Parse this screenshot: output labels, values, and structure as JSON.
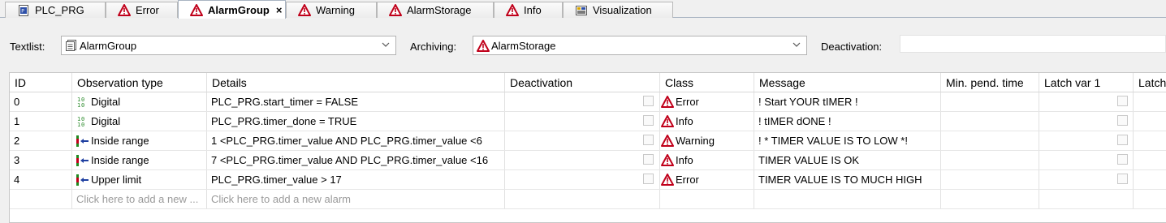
{
  "tabs": [
    {
      "label": "PLC_PRG",
      "icon": "program-icon",
      "active": false
    },
    {
      "label": "Error",
      "icon": "alarm-class-icon",
      "active": false
    },
    {
      "label": "AlarmGroup",
      "icon": "alarm-class-icon",
      "active": true,
      "close": "×"
    },
    {
      "label": "Warning",
      "icon": "alarm-class-icon",
      "active": false
    },
    {
      "label": "AlarmStorage",
      "icon": "alarm-storage-icon",
      "active": false
    },
    {
      "label": "Info",
      "icon": "alarm-class-icon",
      "active": false
    },
    {
      "label": "Visualization",
      "icon": "visualization-icon",
      "active": false
    }
  ],
  "form": {
    "textlist_label": "Textlist:",
    "textlist_value": "AlarmGroup",
    "archiving_label": "Archiving:",
    "archiving_value": "AlarmStorage",
    "deactivation_label": "Deactivation:",
    "deactivation_value": ""
  },
  "table": {
    "columns": [
      "ID",
      "Observation type",
      "Details",
      "Deactivation",
      "Class",
      "Message",
      "Min. pend. time",
      "Latch var 1",
      "Latch"
    ],
    "rows": [
      {
        "id": "0",
        "type": "Digital",
        "type_icon": "digital-icon",
        "details": "PLC_PRG.start_timer = FALSE",
        "class": "Error",
        "message": "! Start YOUR tIMER !"
      },
      {
        "id": "1",
        "type": "Digital",
        "type_icon": "digital-icon",
        "details": "PLC_PRG.timer_done = TRUE",
        "class": "Info",
        "message": "! tIMER dONE !"
      },
      {
        "id": "2",
        "type": "Inside range",
        "type_icon": "range-icon",
        "details": "1 <PLC_PRG.timer_value AND PLC_PRG.timer_value <6",
        "class": "Warning",
        "message": "! * TIMER VALUE IS TO LOW *!"
      },
      {
        "id": "3",
        "type": "Inside range",
        "type_icon": "range-icon",
        "details": "7 <PLC_PRG.timer_value AND PLC_PRG.timer_value <16",
        "class": "Info",
        "message": "TIMER VALUE IS OK"
      },
      {
        "id": "4",
        "type": "Upper limit",
        "type_icon": "range-icon",
        "details": "PLC_PRG.timer_value > 17",
        "class": "Error",
        "message": "TIMER VALUE IS TO MUCH HIGH"
      }
    ],
    "new_row": {
      "type_placeholder": "Click here to add a new ...",
      "details_placeholder": "Click here to add a new alarm"
    }
  },
  "colors": {
    "alarm_red": "#c0001a",
    "tab_border": "#a9b4c2",
    "placeholder": "#9a9a9a"
  }
}
